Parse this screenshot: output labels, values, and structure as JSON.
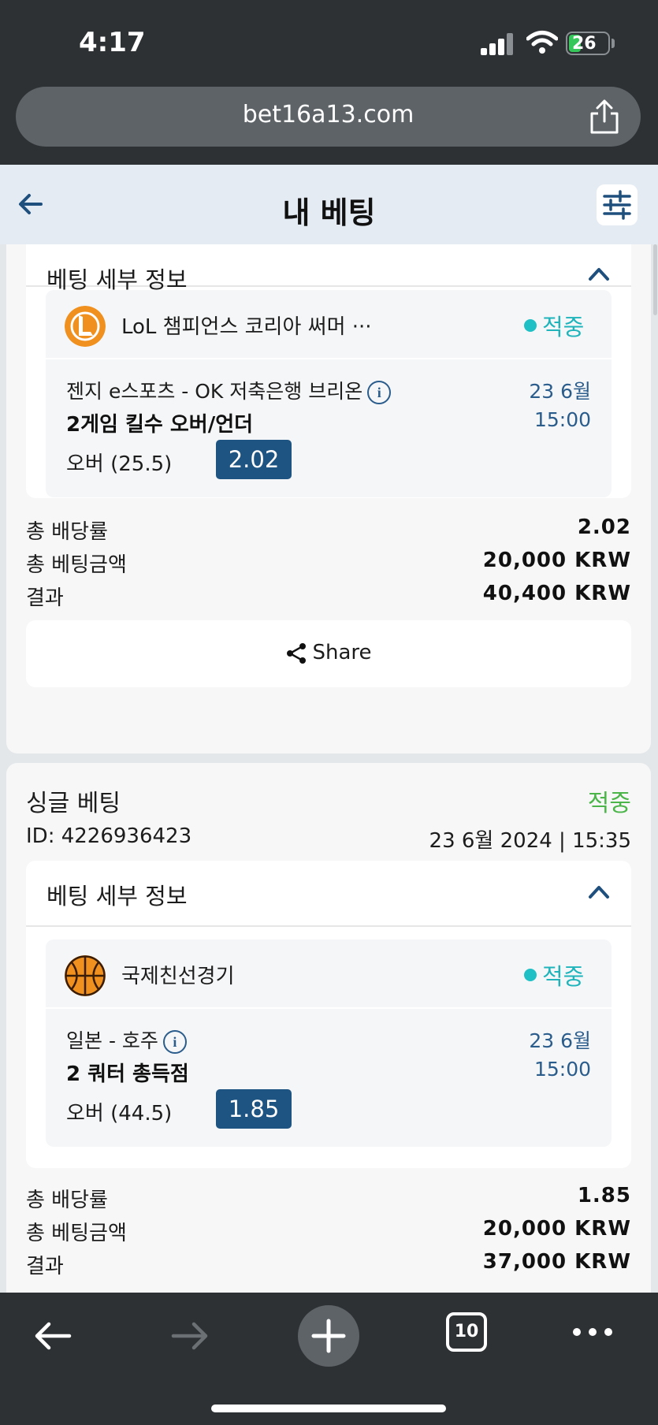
{
  "status_bar": {
    "time": "4:17",
    "battery": "26"
  },
  "browser": {
    "url": "bet16a13.com",
    "tab_count": "10"
  },
  "header": {
    "title": "내 베팅"
  },
  "bets": [
    {
      "details_title": "베팅 세부 정보",
      "league": "LoL 챔피언스 코리아 써머 ···",
      "status": "적중",
      "match": "젠지 e스포츠 - OK 저축은행 브리온",
      "date": "23 6월",
      "time": "15:00",
      "market": "2게임 킬수 오버/언더",
      "selection": "오버 (25.5)",
      "odds": "2.02",
      "total_odds_label": "총 배당률",
      "total_odds": "2.02",
      "stake_label": "총 베팅금액",
      "stake": "20,000 KRW",
      "result_label": "결과",
      "result": "40,400 KRW",
      "share_label": "Share"
    },
    {
      "bet_type": "싱글 베팅",
      "bet_result": "적중",
      "id_text": "ID: 4226936423",
      "placed_at": "23 6월 2024 | 15:35",
      "details_title": "베팅 세부 정보",
      "league": "국제친선경기",
      "status": "적중",
      "match": "일본 - 호주",
      "date": "23 6월",
      "time": "15:00",
      "market": "2 쿼터 총득점",
      "selection": "오버 (44.5)",
      "odds": "1.85",
      "total_odds_label": "총 배당률",
      "total_odds": "1.85",
      "stake_label": "총 베팅금액",
      "stake": "20,000 KRW",
      "result_label": "결과",
      "result": "37,000 KRW"
    }
  ],
  "colors": {
    "accent": "#1e5482",
    "win_teal": "#1fb4bb",
    "win_green": "#4cb54a",
    "header_bg": "#e4ebf2"
  },
  "icons": [
    "back-arrow-icon",
    "filter-sliders-icon",
    "lol-logo-icon",
    "basketball-icon",
    "info-icon",
    "chevron-up-icon",
    "share-icon"
  ]
}
